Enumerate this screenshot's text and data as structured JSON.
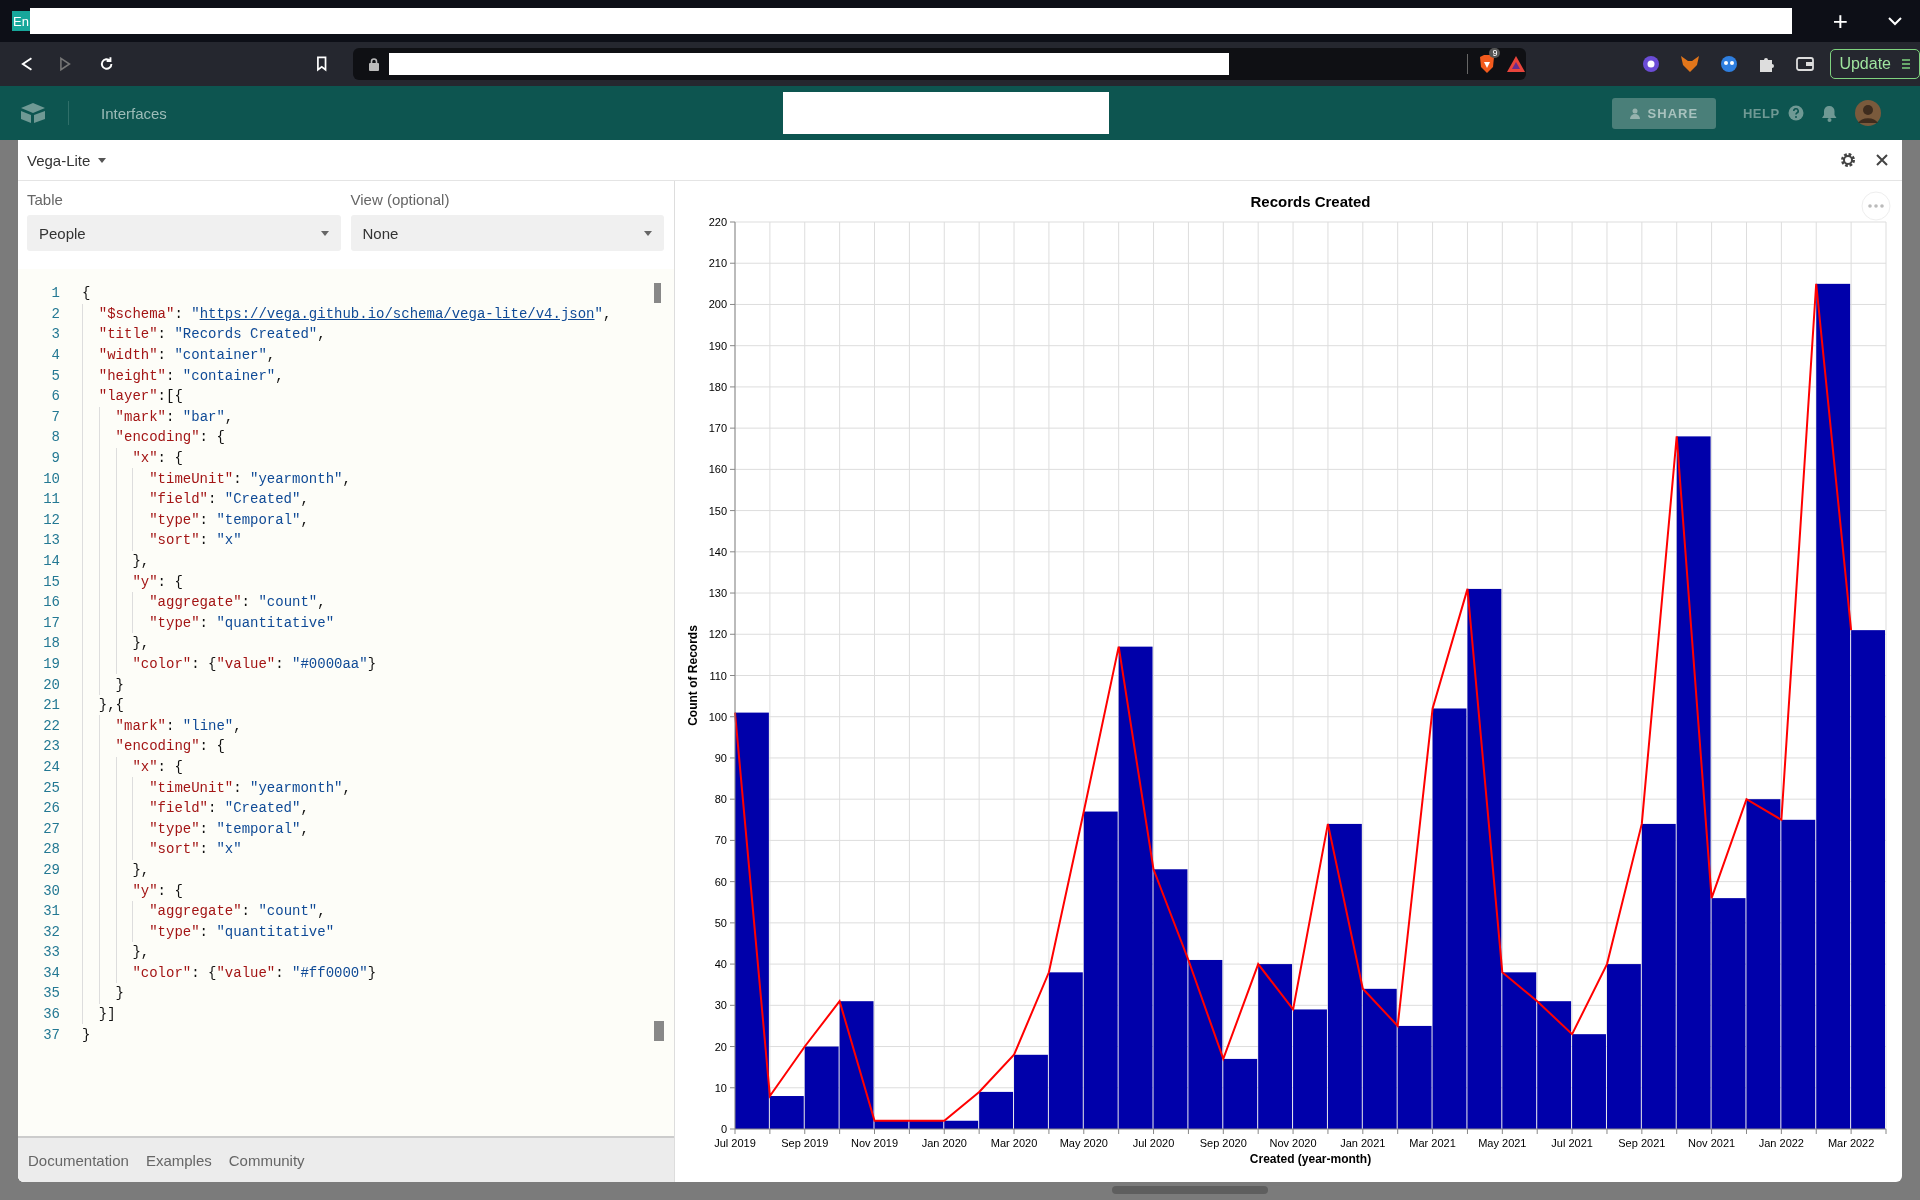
{
  "browser": {
    "tab": {
      "favicon": "En"
    },
    "new_tab": "+",
    "badge": "9",
    "update_button": "Update"
  },
  "app_header": {
    "section": "Interfaces",
    "share": "SHARE",
    "help": "HELP"
  },
  "panel": {
    "title": "Vega-Lite",
    "table_field": {
      "label": "Table",
      "value": "People"
    },
    "view_field": {
      "label": "View (optional)",
      "value": "None"
    },
    "code_lines": [
      {
        "n": "1",
        "text": "{"
      },
      {
        "n": "2",
        "text": "  \"$schema\": \"https://vega.github.io/schema/vega-lite/v4.json\","
      },
      {
        "n": "3",
        "text": "  \"title\": \"Records Created\","
      },
      {
        "n": "4",
        "text": "  \"width\": \"container\","
      },
      {
        "n": "5",
        "text": "  \"height\": \"container\","
      },
      {
        "n": "6",
        "text": "  \"layer\":[{"
      },
      {
        "n": "7",
        "text": "    \"mark\": \"bar\","
      },
      {
        "n": "8",
        "text": "    \"encoding\": {"
      },
      {
        "n": "9",
        "text": "      \"x\": {"
      },
      {
        "n": "10",
        "text": "        \"timeUnit\": \"yearmonth\","
      },
      {
        "n": "11",
        "text": "        \"field\": \"Created\","
      },
      {
        "n": "12",
        "text": "        \"type\": \"temporal\","
      },
      {
        "n": "13",
        "text": "        \"sort\": \"x\""
      },
      {
        "n": "14",
        "text": "      },"
      },
      {
        "n": "15",
        "text": "      \"y\": {"
      },
      {
        "n": "16",
        "text": "        \"aggregate\": \"count\","
      },
      {
        "n": "17",
        "text": "        \"type\": \"quantitative\""
      },
      {
        "n": "18",
        "text": "      },"
      },
      {
        "n": "19",
        "text": "      \"color\": {\"value\": \"#0000aa\"}"
      },
      {
        "n": "20",
        "text": "    }"
      },
      {
        "n": "21",
        "text": "  },{"
      },
      {
        "n": "22",
        "text": "    \"mark\": \"line\","
      },
      {
        "n": "23",
        "text": "    \"encoding\": {"
      },
      {
        "n": "24",
        "text": "      \"x\": {"
      },
      {
        "n": "25",
        "text": "        \"timeUnit\": \"yearmonth\","
      },
      {
        "n": "26",
        "text": "        \"field\": \"Created\","
      },
      {
        "n": "27",
        "text": "        \"type\": \"temporal\","
      },
      {
        "n": "28",
        "text": "        \"sort\": \"x\""
      },
      {
        "n": "29",
        "text": "      },"
      },
      {
        "n": "30",
        "text": "      \"y\": {"
      },
      {
        "n": "31",
        "text": "        \"aggregate\": \"count\","
      },
      {
        "n": "32",
        "text": "        \"type\": \"quantitative\""
      },
      {
        "n": "33",
        "text": "      },"
      },
      {
        "n": "34",
        "text": "      \"color\": {\"value\": \"#ff0000\"}"
      },
      {
        "n": "35",
        "text": "    }"
      },
      {
        "n": "36",
        "text": "  }]"
      },
      {
        "n": "37",
        "text": "}"
      }
    ],
    "footer_links": [
      "Documentation",
      "Examples",
      "Community"
    ],
    "chart_data": {
      "type": "bar",
      "title": "Records Created",
      "xlabel": "Created (year-month)",
      "ylabel": "Count of Records",
      "categories": [
        "Jul 2019",
        null,
        "Sep 2019",
        null,
        "Nov 2019",
        null,
        "Jan 2020",
        null,
        "Mar 2020",
        null,
        "May 2020",
        null,
        "Jul 2020",
        null,
        "Sep 2020",
        null,
        "Nov 2020",
        null,
        "Jan 2021",
        null,
        "Mar 2021",
        null,
        "May 2021",
        null,
        "Jul 2021",
        null,
        "Sep 2021",
        null,
        "Nov 2021",
        null,
        "Jan 2022",
        null,
        "Mar 2022"
      ],
      "ylim": [
        0,
        220
      ],
      "grid": true,
      "yticks": [
        0,
        10,
        20,
        30,
        40,
        50,
        60,
        70,
        80,
        90,
        100,
        110,
        120,
        130,
        140,
        150,
        160,
        170,
        180,
        190,
        200,
        210,
        220
      ],
      "series": [
        {
          "type": "bar",
          "color": "#0000aa",
          "values": [
            101,
            8,
            20,
            31,
            2,
            2,
            2,
            9,
            18,
            38,
            77,
            117,
            63,
            41,
            17,
            40,
            29,
            74,
            34,
            25,
            102,
            131,
            38,
            31,
            23,
            40,
            74,
            168,
            56,
            80,
            75,
            205,
            121
          ]
        },
        {
          "type": "line",
          "color": "#ff0000",
          "values": [
            101,
            8,
            20,
            31,
            2,
            2,
            2,
            9,
            18,
            38,
            77,
            117,
            63,
            41,
            17,
            40,
            29,
            74,
            34,
            25,
            102,
            131,
            38,
            31,
            23,
            40,
            74,
            168,
            56,
            80,
            75,
            205,
            121
          ]
        }
      ]
    }
  }
}
